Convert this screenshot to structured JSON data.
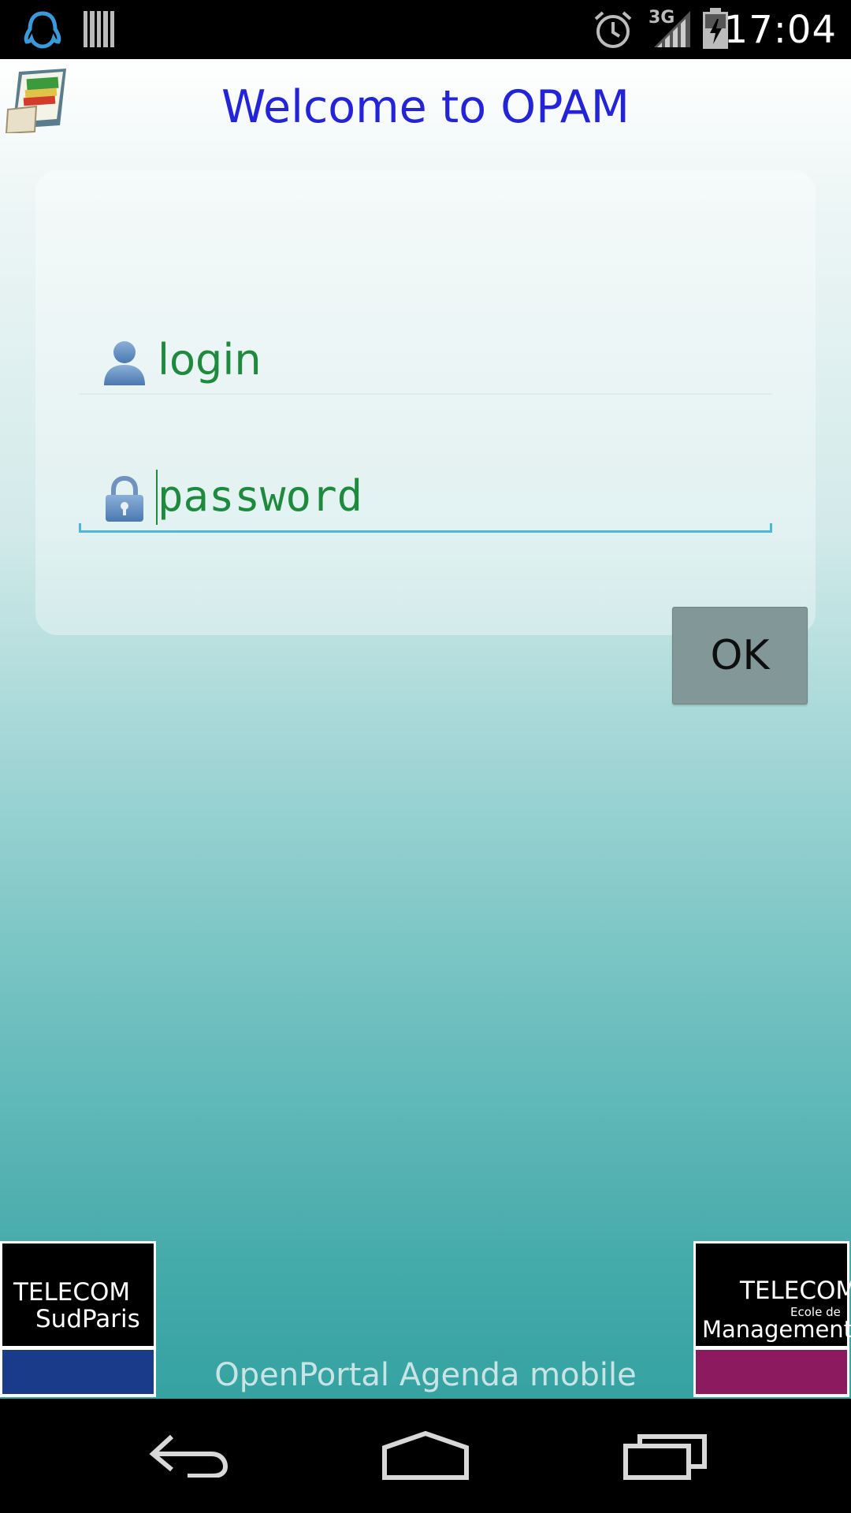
{
  "status_bar": {
    "time": "17:04",
    "network": "3G",
    "icons": [
      "qq-penguin-icon",
      "barcode-icon",
      "alarm-icon",
      "signal-icon",
      "battery-icon"
    ]
  },
  "header": {
    "title": "Welcome to OPAM",
    "app_icon": "calendar-notebook-icon"
  },
  "login_form": {
    "login_value": "login",
    "password_value": "password",
    "ok_label": "OK"
  },
  "footer": {
    "caption": "OpenPortal Agenda mobile",
    "logo_left": {
      "line1": "TELECOM",
      "line2": "SudParis"
    },
    "logo_right": {
      "line1": "TELECOM",
      "line2": "Ecole de",
      "line3": "Management"
    }
  },
  "nav_bar": {
    "icons": [
      "back-icon",
      "home-icon",
      "recent-apps-icon"
    ]
  },
  "colors": {
    "title": "#2323d8",
    "field_text": "#1e8a3e",
    "focus_underline": "#4db6dc",
    "button": "#829797",
    "bg_bottom": "#35a2a2"
  }
}
